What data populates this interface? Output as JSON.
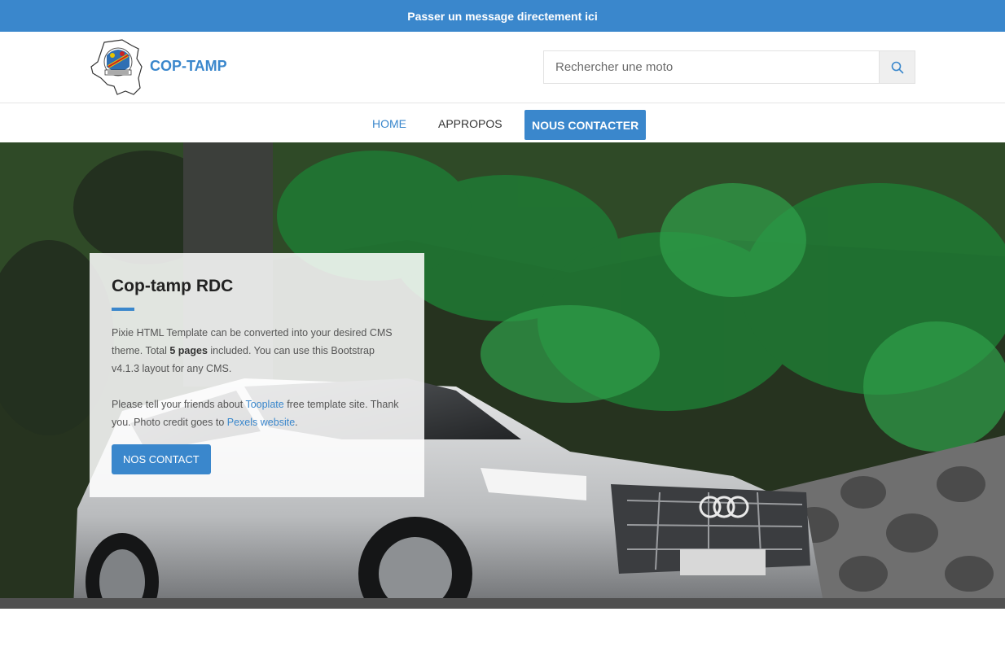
{
  "topbar": {
    "message": "Passer un message directement ici"
  },
  "header": {
    "brand": "COP-TAMP",
    "search": {
      "placeholder": "Rechercher une moto",
      "value": ""
    }
  },
  "nav": {
    "items": [
      {
        "label": "Home"
      },
      {
        "label": "Appropos"
      },
      {
        "label": "Nous contacter"
      }
    ]
  },
  "hero": {
    "title": "Cop-tamp RDC",
    "para1": {
      "text1": "Pixie HTML Template can be converted into your desired CMS theme. Total ",
      "bold": "5 pages",
      "text2": " included. You can use this Bootstrap v4.1.3 layout for any CMS."
    },
    "para2": {
      "text1": "Please tell your friends about ",
      "link1": "Tooplate",
      "text2": " free template site. Thank you. Photo credit goes to ",
      "link2": "Pexels website",
      "text3": "."
    },
    "button": "Nos contact"
  },
  "colors": {
    "accent": "#3a87cc",
    "topbar": "#3a87cc"
  },
  "icons": {
    "search": "search-icon",
    "logo": "coat-of-arms-logo"
  }
}
